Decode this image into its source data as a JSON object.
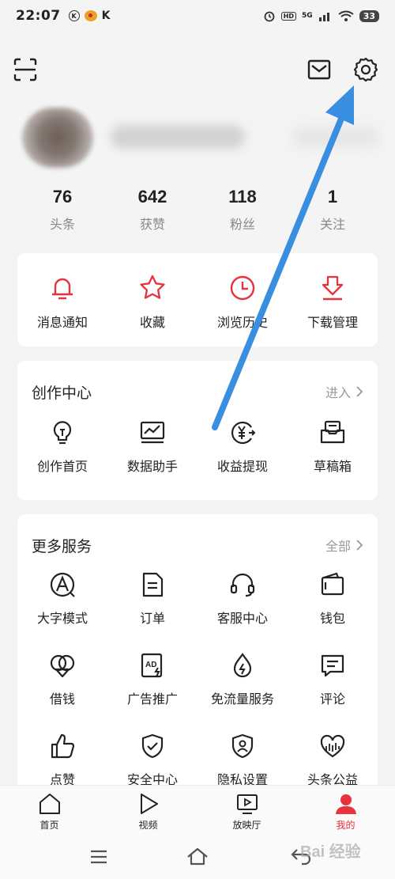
{
  "status_bar": {
    "time": "22:07",
    "signal": "5G",
    "hd": "HD",
    "battery": "33",
    "k_label": "K"
  },
  "profile": {
    "stats": [
      {
        "value": "76",
        "label": "头条"
      },
      {
        "value": "642",
        "label": "获赞"
      },
      {
        "value": "118",
        "label": "粉丝"
      },
      {
        "value": "1",
        "label": "关注"
      }
    ]
  },
  "quick_actions": [
    {
      "label": "消息通知",
      "icon": "bell-icon"
    },
    {
      "label": "收藏",
      "icon": "star-icon"
    },
    {
      "label": "浏览历史",
      "icon": "clock-icon"
    },
    {
      "label": "下载管理",
      "icon": "download-icon"
    }
  ],
  "creator_center": {
    "title": "创作中心",
    "more": "进入",
    "items": [
      {
        "label": "创作首页",
        "icon": "lightbulb-icon"
      },
      {
        "label": "数据助手",
        "icon": "chart-icon"
      },
      {
        "label": "收益提现",
        "icon": "yuan-icon"
      },
      {
        "label": "草稿箱",
        "icon": "draft-box-icon"
      }
    ]
  },
  "more_services": {
    "title": "更多服务",
    "more": "全部",
    "items": [
      {
        "label": "大字模式",
        "icon": "large-font-icon"
      },
      {
        "label": "订单",
        "icon": "order-icon"
      },
      {
        "label": "客服中心",
        "icon": "headset-icon"
      },
      {
        "label": "钱包",
        "icon": "wallet-icon"
      },
      {
        "label": "借钱",
        "icon": "loan-icon"
      },
      {
        "label": "广告推广",
        "icon": "ad-icon"
      },
      {
        "label": "免流量服务",
        "icon": "data-drop-icon"
      },
      {
        "label": "评论",
        "icon": "comment-icon"
      },
      {
        "label": "点赞",
        "icon": "thumbs-up-icon"
      },
      {
        "label": "安全中心",
        "icon": "shield-icon"
      },
      {
        "label": "隐私设置",
        "icon": "privacy-icon"
      },
      {
        "label": "头条公益",
        "icon": "charity-icon"
      }
    ]
  },
  "bottom_nav": [
    {
      "label": "首页",
      "icon": "home-icon"
    },
    {
      "label": "视频",
      "icon": "play-icon"
    },
    {
      "label": "放映厅",
      "icon": "cinema-icon"
    },
    {
      "label": "我的",
      "icon": "profile-icon",
      "active": true
    }
  ],
  "watermark": "Bai 经验",
  "colors": {
    "accent": "#e8323c",
    "arrow": "#3a8ee0",
    "background": "#f4f4f4"
  }
}
